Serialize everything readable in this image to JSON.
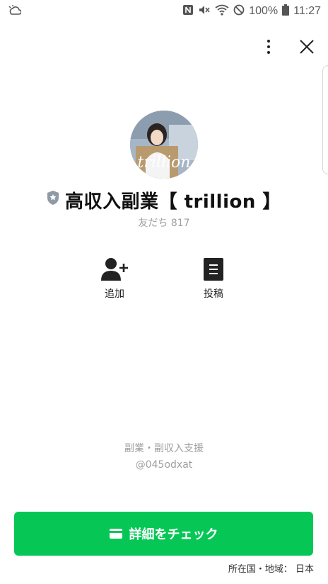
{
  "status_bar": {
    "battery_text": "100%",
    "time": "11:27"
  },
  "profile": {
    "name": "高収入副業【 trillion 】",
    "friends_text": "友だち 817",
    "avatar_text": "trillion"
  },
  "actions": [
    {
      "label": "追加",
      "icon": "add-friend-icon"
    },
    {
      "label": "投稿",
      "icon": "post-icon"
    }
  ],
  "description": {
    "category": "副業・副収入支援",
    "id": "@045odxat"
  },
  "cta": {
    "label": "詳細をチェック",
    "icon": "wallet-icon"
  },
  "footer": {
    "country": "所在国・地域： 日本"
  },
  "colors": {
    "accent": "#06c755"
  }
}
